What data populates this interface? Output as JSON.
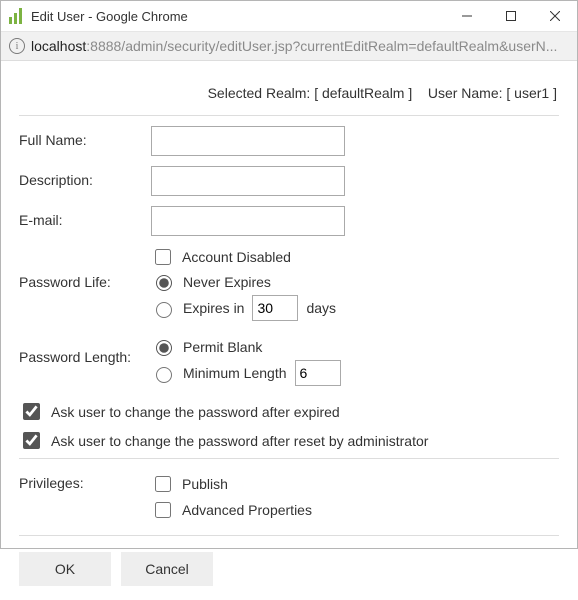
{
  "window": {
    "title": "Edit User - Google Chrome"
  },
  "address": {
    "host": "localhost",
    "path": ":8888/admin/security/editUser.jsp?currentEditRealm=defaultRealm&userN..."
  },
  "context": {
    "realm_label": "Selected Realm:",
    "realm_value": "[ defaultRealm ]",
    "user_label": "User Name:",
    "user_value": "[ user1 ]"
  },
  "labels": {
    "full_name": "Full Name:",
    "description": "Description:",
    "email": "E-mail:",
    "password_life": "Password Life:",
    "password_length": "Password Length:",
    "privileges": "Privileges:"
  },
  "fields": {
    "full_name": "",
    "description": "",
    "email": "",
    "expires_days": "30",
    "min_length": "6"
  },
  "options": {
    "account_disabled": "Account Disabled",
    "never_expires": "Never Expires",
    "expires_in": "Expires in",
    "days_suffix": "days",
    "permit_blank": "Permit Blank",
    "minimum_length": "Minimum Length",
    "change_after_expired": "Ask user to change the password after expired",
    "change_after_reset": "Ask user to change the password after reset by administrator",
    "publish": "Publish",
    "advanced_properties": "Advanced Properties"
  },
  "buttons": {
    "ok": "OK",
    "cancel": "Cancel"
  }
}
